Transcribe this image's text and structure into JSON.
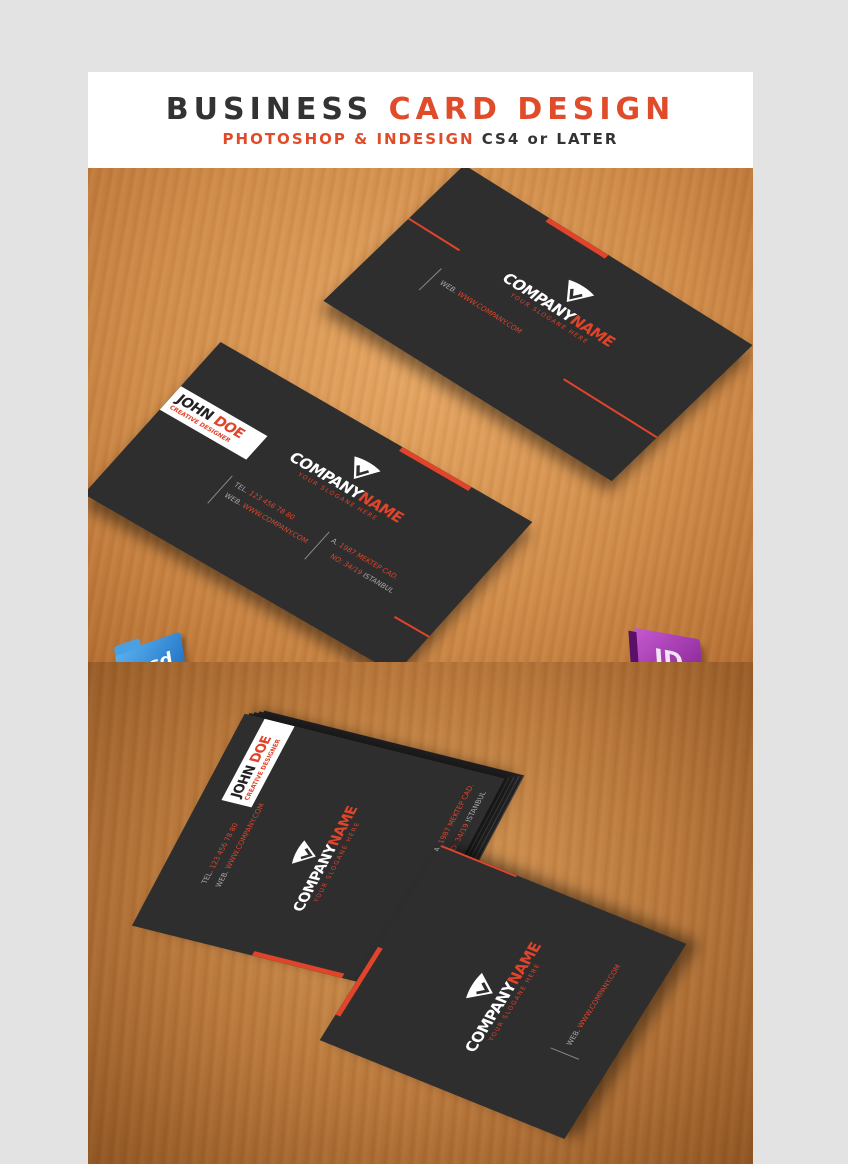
{
  "header": {
    "title_part1": "BUSINESS ",
    "title_part2": "CARD DESIGN",
    "subtitle_part1": "PHOTOSHOP & INDESIGN ",
    "subtitle_part2": "CS4 or LATER"
  },
  "card": {
    "company_first": "COMPANY",
    "company_second": "NAME",
    "slogan": "YOUR SLOGANE HERE",
    "person_first": "JOHN ",
    "person_last": "DOE",
    "role": "CREATIVE DESIGNER",
    "tel_label": "TEL.",
    "tel_value": "123 456 78 80",
    "web_label": "WEB.",
    "web_value": "WWW.COMPANY.COM",
    "address_label": "A.",
    "address_line1": "1987 MEKTEP CAD.",
    "address_line2_prefix": "NO: 34/19",
    "address_line2_suffix": " ISTANBUL"
  },
  "icons": {
    "psd_label": ".psd",
    "id_label": "ID"
  },
  "colors": {
    "accent": "#e0442a",
    "card": "#2e2e2e",
    "wood": "#d08c4a"
  }
}
